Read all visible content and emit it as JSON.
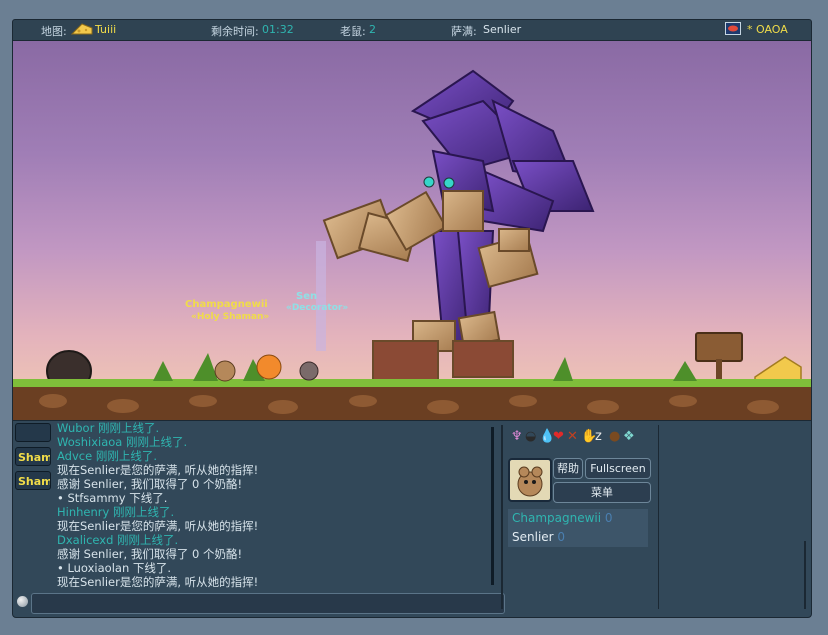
{
  "topbar": {
    "map_label": "地图:",
    "map_value": "Tuiii",
    "time_label": "剩余时间:",
    "time_value": "01:32",
    "mice_label": "老鼠:",
    "mice_value": "2",
    "shaman_label": "萨满:",
    "shaman_value": "Senlier",
    "room_value": "* OAOA"
  },
  "scene": {
    "player1_name": "Champagnewii",
    "player1_title": "«Holy Shaman»",
    "player2_name": "Sen",
    "player2_title": "«Decorator»"
  },
  "side_buttons": [
    "",
    "Shamb",
    "Shamb"
  ],
  "chat": [
    {
      "text": "Wubor 刚刚上线了.",
      "color": "cyan"
    },
    {
      "text": "Woshixiaoa 刚刚上线了.",
      "color": "cyan"
    },
    {
      "text": "Advce 刚刚上线了.",
      "color": "cyan"
    },
    {
      "text": "现在Senlier是您的萨满, 听从她的指挥!",
      "color": "white"
    },
    {
      "text": "感谢 Senlier, 我们取得了 0 个奶酪!",
      "color": "mixed"
    },
    {
      "text": "• Stfsammy 下线了.",
      "color": "white"
    },
    {
      "text": "Hinhenry 刚刚上线了.",
      "color": "cyan"
    },
    {
      "text": "现在Senlier是您的萨满, 听从她的指挥!",
      "color": "white"
    },
    {
      "text": "Dxalicexd 刚刚上线了.",
      "color": "cyan"
    },
    {
      "text": "感谢 Senlier, 我们取得了 0 个奶酪!",
      "color": "mixed"
    },
    {
      "text": "• Luoxiaolan 下线了.",
      "color": "white"
    },
    {
      "text": "现在Senlier是您的萨满, 听从她的指挥!",
      "color": "white"
    }
  ],
  "chat_input": {
    "value": ""
  },
  "buttons": {
    "help": "帮助",
    "fullscreen": "Fullscreen",
    "menu": "菜单"
  },
  "players": [
    {
      "name": "Champagnewii",
      "score": "0",
      "color": "#2fb5b0"
    },
    {
      "name": "Senlier",
      "score": "0",
      "color": "#e3ecf2"
    }
  ],
  "colors": {
    "cyan": "#2fb5b0",
    "yellow": "#f0dc49",
    "panel": "#324859"
  }
}
